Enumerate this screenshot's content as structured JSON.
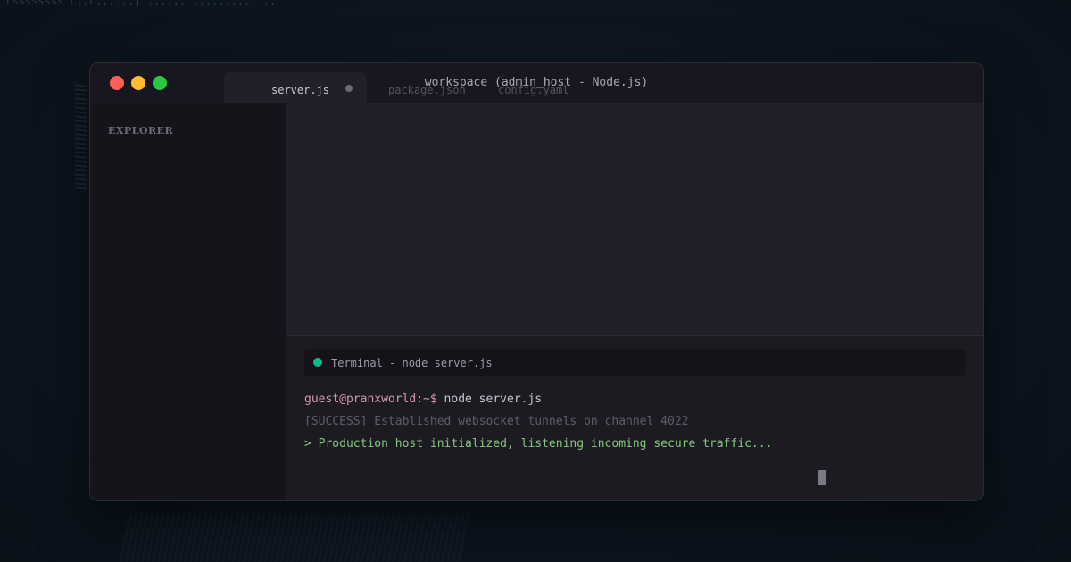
{
  "background": {
    "code_text": "rssssssss c[;c;;;:;;]  ;;;;;;  ;;;;;;;;;:  ;;"
  },
  "window": {
    "title": "workspace (admin_host - Node.js)",
    "controls": {
      "close_color": "#fe5f57",
      "minimize_color": "#febc2e",
      "maximize_color": "#28c840"
    },
    "tabs": [
      {
        "label": "server.js",
        "active": true
      },
      {
        "label": "package.json",
        "active": false
      },
      {
        "label": "config.yaml",
        "active": false
      }
    ]
  },
  "sidebar": {
    "title": "EXPLORER"
  },
  "terminal": {
    "header_label": "Terminal - node server.js",
    "status_color": "#13b98a",
    "prompt": "guest@pranxworld:~$",
    "command": "node server.js",
    "output_success": "[SUCCESS] Established websocket tunnels on channel 4022",
    "output_info": "> Production host initialized, listening incoming secure traffic..."
  }
}
